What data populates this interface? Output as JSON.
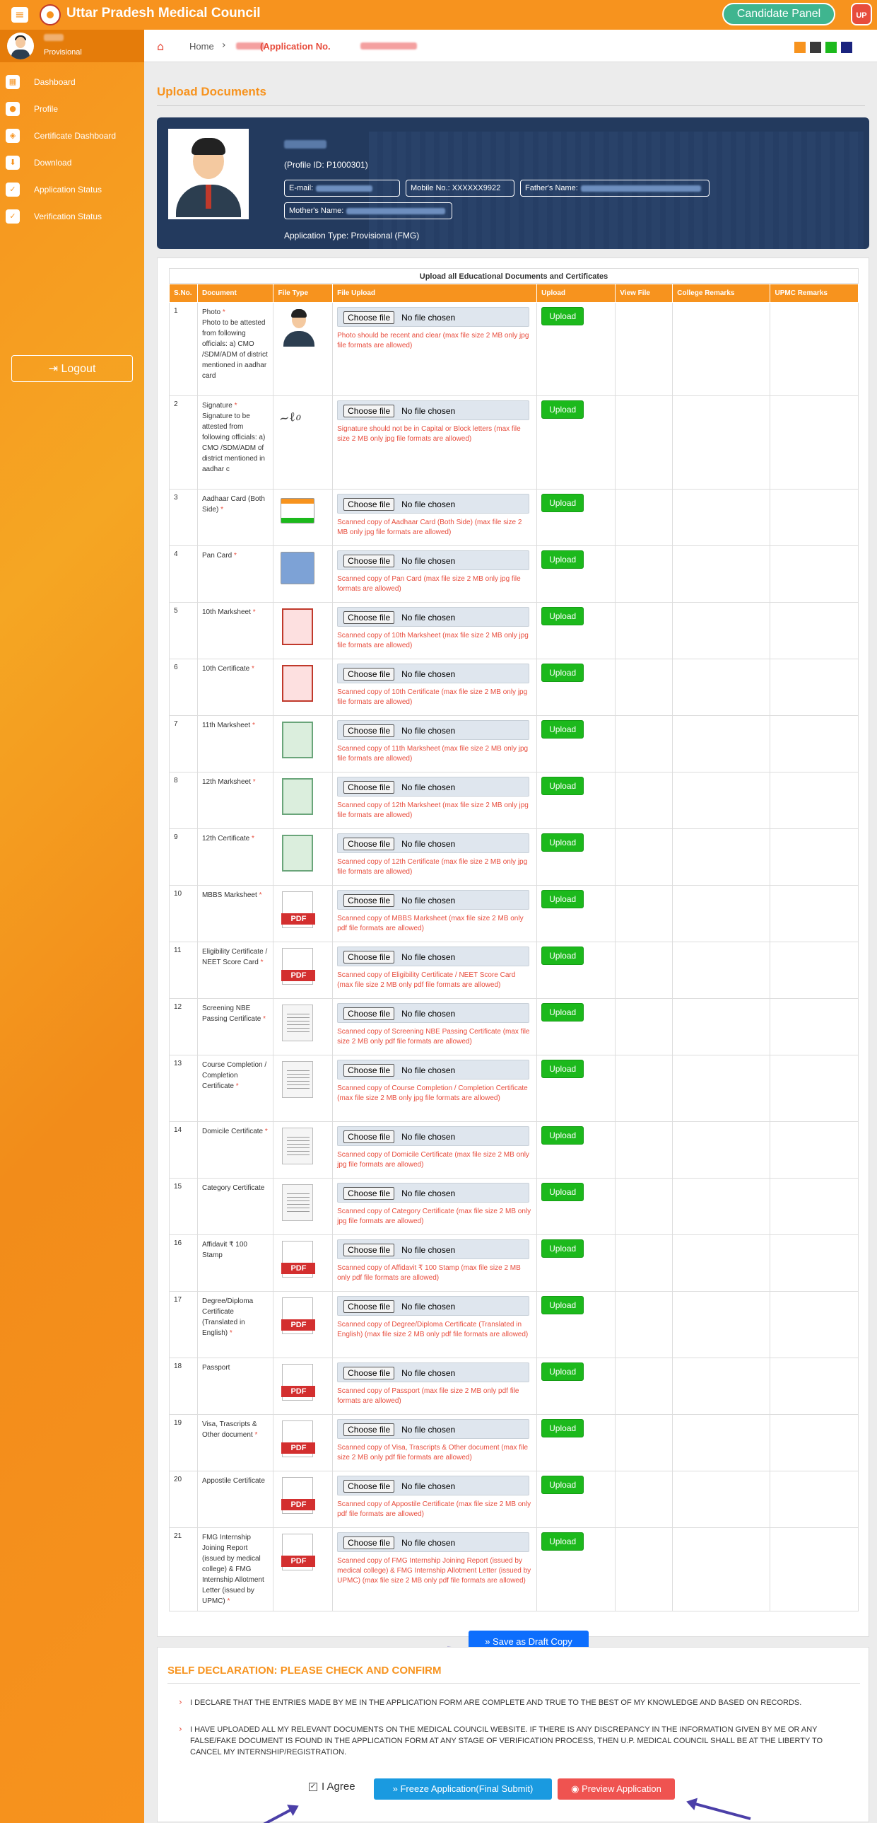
{
  "app": {
    "title": "Uttar Pradesh Medical Council",
    "candidate_panel": "Candidate Panel",
    "badge": "UP"
  },
  "sidebar": {
    "role": "Provisional",
    "items": [
      {
        "label": "Dashboard",
        "icon": "dashboard-icon",
        "glyph": "▦"
      },
      {
        "label": "Profile",
        "icon": "user-icon",
        "glyph": "●"
      },
      {
        "label": "Certificate Dashboard",
        "icon": "certificate-icon",
        "glyph": "◈"
      },
      {
        "label": "Download",
        "icon": "download-icon",
        "glyph": "⬇"
      },
      {
        "label": "Application Status",
        "icon": "check-circle-icon",
        "glyph": "✓"
      },
      {
        "label": "Verification Status",
        "icon": "check-circle-icon",
        "glyph": "✓"
      }
    ],
    "logout": "Logout"
  },
  "breadcrumb": {
    "home": "Home",
    "current": "(Application No."
  },
  "theme_swatches": [
    "#f7931e",
    "#3a3a3a",
    "#1cb91c",
    "#1a237e"
  ],
  "page": {
    "title": "Upload Documents"
  },
  "profile": {
    "id": "(Profile ID: P1000301)",
    "email_label": "E-mail:",
    "mobile": "Mobile No.: XXXXXX9922",
    "father_label": "Father's Name:",
    "mother_label": "Mother's Name:",
    "app_type": "Application Type: Provisional (FMG)"
  },
  "table": {
    "caption": "Upload all Educational Documents and Certificates",
    "headers": [
      "S.No.",
      "Document",
      "File Type",
      "File Upload",
      "Upload",
      "View File",
      "College Remarks",
      "UPMC Remarks"
    ],
    "choose_label": "Choose file",
    "no_file": "No file chosen",
    "upload_label": "Upload",
    "rows": [
      {
        "no": "1",
        "doc": "Photo",
        "req": true,
        "extra": "Photo to be attested from following officials: a) CMO /SDM/ADM of district mentioned in aadhar card",
        "type": "person",
        "hint": "Photo should be recent and clear (max file size 2 MB only jpg file formats are allowed)"
      },
      {
        "no": "2",
        "doc": "Signature",
        "req": true,
        "extra": "Signature to be attested from following officials: a) CMO /SDM/ADM of district mentioned in aadhar c",
        "type": "sign",
        "hint": "Signature should not be in Capital or Block letters (max file size 2 MB only jpg file formats are allowed)"
      },
      {
        "no": "3",
        "doc": "Aadhaar Card (Both Side)",
        "req": true,
        "extra": "",
        "type": "aadhaar",
        "hint": "Scanned copy of Aadhaar Card (Both Side) (max file size 2 MB only jpg file formats are allowed)"
      },
      {
        "no": "4",
        "doc": "Pan Card",
        "req": true,
        "extra": "",
        "type": "pan",
        "hint": "Scanned copy of Pan Card (max file size 2 MB only jpg file formats are allowed)"
      },
      {
        "no": "5",
        "doc": "10th Marksheet",
        "req": true,
        "extra": "",
        "type": "red",
        "hint": "Scanned copy of 10th Marksheet (max file size 2 MB only jpg file formats are allowed)"
      },
      {
        "no": "6",
        "doc": "10th Certificate",
        "req": true,
        "extra": "",
        "type": "red",
        "hint": "Scanned copy of 10th Certificate (max file size 2 MB only jpg file formats are allowed)"
      },
      {
        "no": "7",
        "doc": "11th Marksheet",
        "req": true,
        "extra": "",
        "type": "green",
        "hint": "Scanned copy of 11th Marksheet (max file size 2 MB only jpg file formats are allowed)"
      },
      {
        "no": "8",
        "doc": "12th Marksheet",
        "req": true,
        "extra": "",
        "type": "green",
        "hint": "Scanned copy of 12th Marksheet (max file size 2 MB only jpg file formats are allowed)"
      },
      {
        "no": "9",
        "doc": "12th Certificate",
        "req": true,
        "extra": "",
        "type": "green",
        "hint": "Scanned copy of 12th Certificate (max file size 2 MB only jpg file formats are allowed)"
      },
      {
        "no": "10",
        "doc": "MBBS Marksheet",
        "req": true,
        "extra": "",
        "type": "pdf",
        "hint": "Scanned copy of MBBS Marksheet (max file size 2 MB only pdf file formats are allowed)"
      },
      {
        "no": "11",
        "doc": "Eligibility Certificate / NEET Score Card",
        "req": true,
        "extra": "",
        "type": "pdf",
        "hint": "Scanned copy of Eligibility Certificate / NEET Score Card (max file size 2 MB only pdf file formats are allowed)"
      },
      {
        "no": "12",
        "doc": "Screening NBE Passing Certificate",
        "req": true,
        "extra": "",
        "type": "gen",
        "hint": "Scanned copy of Screening NBE Passing Certificate (max file size 2 MB only pdf file formats are allowed)"
      },
      {
        "no": "13",
        "doc": "Course Completion / Completion Certificate",
        "req": true,
        "extra": "",
        "type": "gen",
        "hint": "Scanned copy of Course Completion / Completion Certificate (max file size 2 MB only jpg file formats are allowed)"
      },
      {
        "no": "14",
        "doc": "Domicile Certificate",
        "req": true,
        "extra": "",
        "type": "gen",
        "hint": "Scanned copy of Domicile Certificate (max file size 2 MB only jpg file formats are allowed)"
      },
      {
        "no": "15",
        "doc": "Category Certificate",
        "req": false,
        "extra": "",
        "type": "gen",
        "hint": "Scanned copy of Category Certificate (max file size 2 MB only jpg file formats are allowed)"
      },
      {
        "no": "16",
        "doc": "Affidavit ₹ 100 Stamp",
        "req": false,
        "extra": "",
        "type": "pdf",
        "hint": "Scanned copy of Affidavit ₹ 100 Stamp (max file size 2 MB only pdf file formats are allowed)"
      },
      {
        "no": "17",
        "doc": "Degree/Diploma Certificate (Translated in English)",
        "req": true,
        "extra": "",
        "type": "pdf",
        "hint": "Scanned copy of Degree/Diploma Certificate (Translated in English) (max file size 2 MB only pdf file formats are allowed)"
      },
      {
        "no": "18",
        "doc": "Passport",
        "req": false,
        "extra": "",
        "type": "pdf",
        "hint": "Scanned copy of Passport (max file size 2 MB only pdf file formats are allowed)"
      },
      {
        "no": "19",
        "doc": "Visa, Trascripts & Other document",
        "req": true,
        "extra": "",
        "type": "pdf",
        "hint": "Scanned copy of Visa, Trascripts & Other document (max file size 2 MB only pdf file formats are allowed)"
      },
      {
        "no": "20",
        "doc": "Appostile Certificate",
        "req": false,
        "extra": "",
        "type": "pdf",
        "hint": "Scanned copy of Appostile Certificate (max file size 2 MB only pdf file formats are allowed)"
      },
      {
        "no": "21",
        "doc": "FMG Internship Joining Report (issued by medical college) & FMG Internship Allotment Letter (issued by UPMC)",
        "req": true,
        "extra": "",
        "type": "pdf",
        "hint": "Scanned copy of FMG Internship Joining Report (issued by medical college) & FMG Internship Allotment Letter (issued by UPMC) (max file size 2 MB only pdf file formats are allowed)"
      }
    ]
  },
  "draft_button": "» Save as Draft Copy",
  "self_declaration": {
    "title": "SELF DECLARATION: PLEASE CHECK AND CONFIRM",
    "items": [
      "I DECLARE THAT THE ENTRIES MADE BY ME IN THE APPLICATION FORM ARE COMPLETE AND TRUE TO THE BEST OF MY KNOWLEDGE AND BASED ON RECORDS.",
      "I HAVE UPLOADED ALL MY RELEVANT DOCUMENTS ON THE MEDICAL COUNCIL WEBSITE. IF THERE IS ANY DISCREPANCY IN THE INFORMATION GIVEN BY ME OR ANY FALSE/FAKE DOCUMENT IS FOUND IN THE APPLICATION FORM AT ANY STAGE OF VERIFICATION PROCESS, THEN U.P. MEDICAL COUNCIL SHALL BE AT THE LIBERTY TO CANCEL MY INTERNSHIP/REGISTRATION."
    ],
    "agree_label": "I Agree",
    "agree_checked": true,
    "freeze_button": "» Freeze Application(Final Submit)",
    "preview_button": "◉ Preview Application"
  }
}
